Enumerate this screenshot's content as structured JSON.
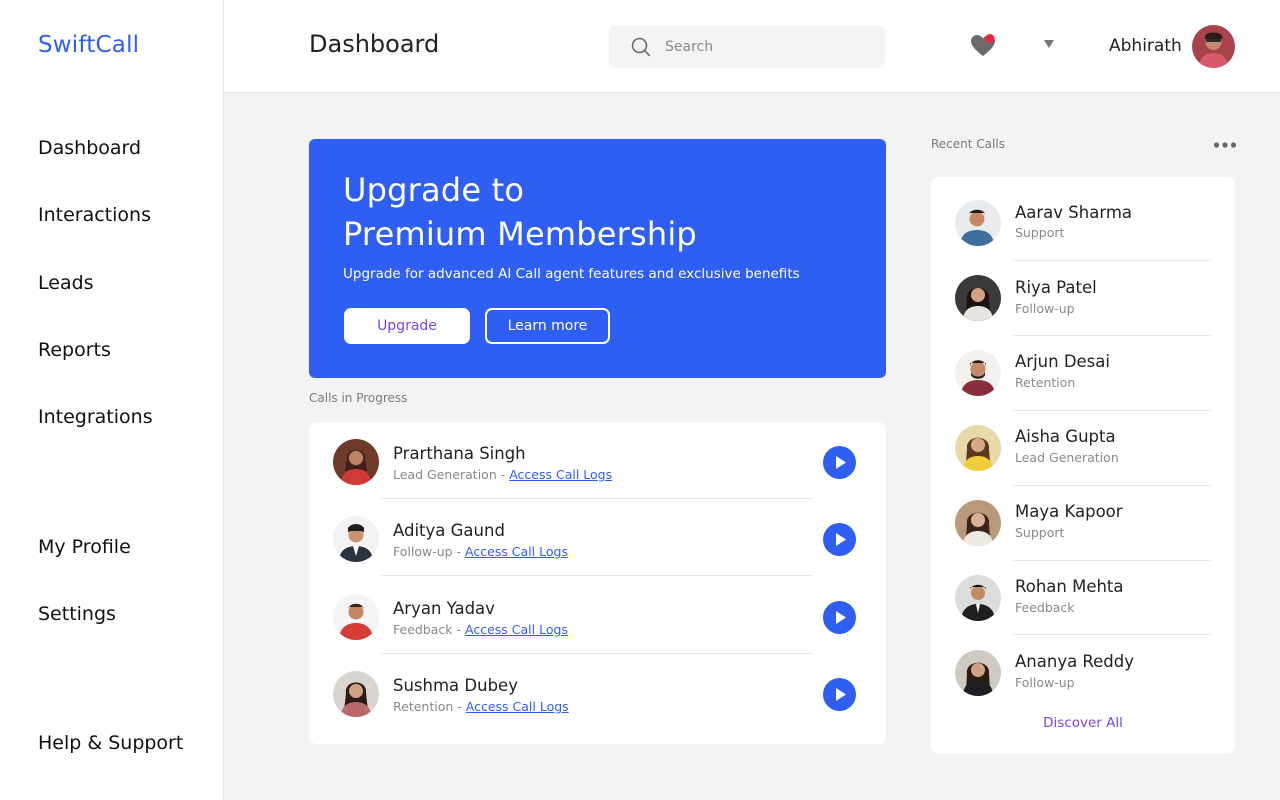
{
  "app": {
    "name": "SwiftCall"
  },
  "sidebar": {
    "items": [
      {
        "label": "Dashboard"
      },
      {
        "label": "Interactions"
      },
      {
        "label": "Leads"
      },
      {
        "label": "Reports"
      },
      {
        "label": "Integrations"
      },
      {
        "label": "My Profile"
      },
      {
        "label": "Settings"
      },
      {
        "label": "Help & Support"
      }
    ]
  },
  "header": {
    "title": "Dashboard",
    "search_placeholder": "Search",
    "username": "Abhirath",
    "notification_icon": "heart-icon",
    "notification_dot_color": "#f0233a"
  },
  "banner": {
    "title_line1": "Upgrade to",
    "title_line2": "Premium Membership",
    "subtitle": "Upgrade for advanced AI Call agent features and exclusive benefits",
    "upgrade_label": "Upgrade",
    "learn_more_label": "Learn more",
    "background_color": "#2f5ef3"
  },
  "calls_in_progress": {
    "label": "Calls in Progress",
    "link_text": "Access Call Logs",
    "items": [
      {
        "name": "Prarthana Singh",
        "category": "Lead Generation"
      },
      {
        "name": "Aditya Gaund",
        "category": "Follow-up"
      },
      {
        "name": "Aryan Yadav",
        "category": "Feedback"
      },
      {
        "name": "Sushma Dubey",
        "category": "Retention"
      }
    ]
  },
  "recent_calls": {
    "label": "Recent Calls",
    "discover_label": "Discover All",
    "items": [
      {
        "name": "Aarav Sharma",
        "role": "Support"
      },
      {
        "name": "Riya Patel",
        "role": "Follow-up"
      },
      {
        "name": "Arjun Desai",
        "role": "Retention"
      },
      {
        "name": "Aisha Gupta",
        "role": "Lead Generation"
      },
      {
        "name": "Maya Kapoor",
        "role": "Support"
      },
      {
        "name": "Rohan Mehta",
        "role": "Feedback"
      },
      {
        "name": "Ananya Reddy",
        "role": "Follow-up"
      }
    ]
  }
}
